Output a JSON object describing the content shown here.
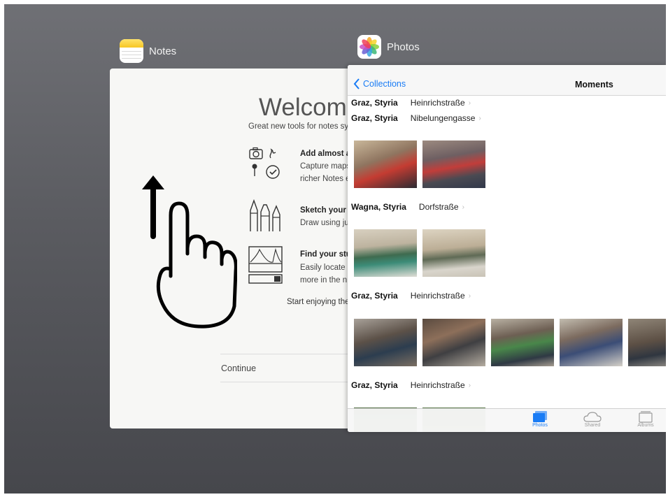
{
  "switcher": {
    "notes_app_label": "Notes",
    "photos_app_label": "Photos"
  },
  "notes": {
    "welcome": "Welcome",
    "subtitle": "Great new tools for notes sy",
    "features": [
      {
        "title": "Add almost a",
        "lines": [
          "Capture maps",
          "richer Notes e"
        ],
        "icon": "camera-sketch-pin-check-icon"
      },
      {
        "title": "Sketch your t",
        "lines": [
          "Draw using ju"
        ],
        "icon": "markers-icon"
      },
      {
        "title": "Find your stu",
        "lines": [
          "Easily locate a",
          "more in the n"
        ],
        "icon": "bridge-drawing-icon"
      }
    ],
    "start_text": "Start enjoying the",
    "continue_label": "Continue"
  },
  "photos": {
    "back_label": "Collections",
    "nav_title": "Moments",
    "top_location": {
      "city": "Graz, Styria",
      "street": "Heinrichstraße"
    },
    "moments": [
      {
        "city": "Graz, Styria",
        "street": "Nibelungengasse",
        "photo_count": 2
      },
      {
        "city": "Wagna, Styria",
        "street": "Dorfstraße",
        "photo_count": 2
      },
      {
        "city": "Graz, Styria",
        "street": "Heinrichstraße",
        "photo_count": 5
      },
      {
        "city": "Graz, Styria",
        "street": "Heinrichstraße",
        "photo_count": 2
      }
    ],
    "tabs": [
      {
        "label": "Photos",
        "active": true,
        "icon": "photos-tab-icon"
      },
      {
        "label": "Shared",
        "active": false,
        "icon": "cloud-icon"
      },
      {
        "label": "Albums",
        "active": false,
        "icon": "albums-icon"
      }
    ]
  },
  "colors": {
    "accent": "#1a7cf5",
    "background": "#5a5b60"
  }
}
